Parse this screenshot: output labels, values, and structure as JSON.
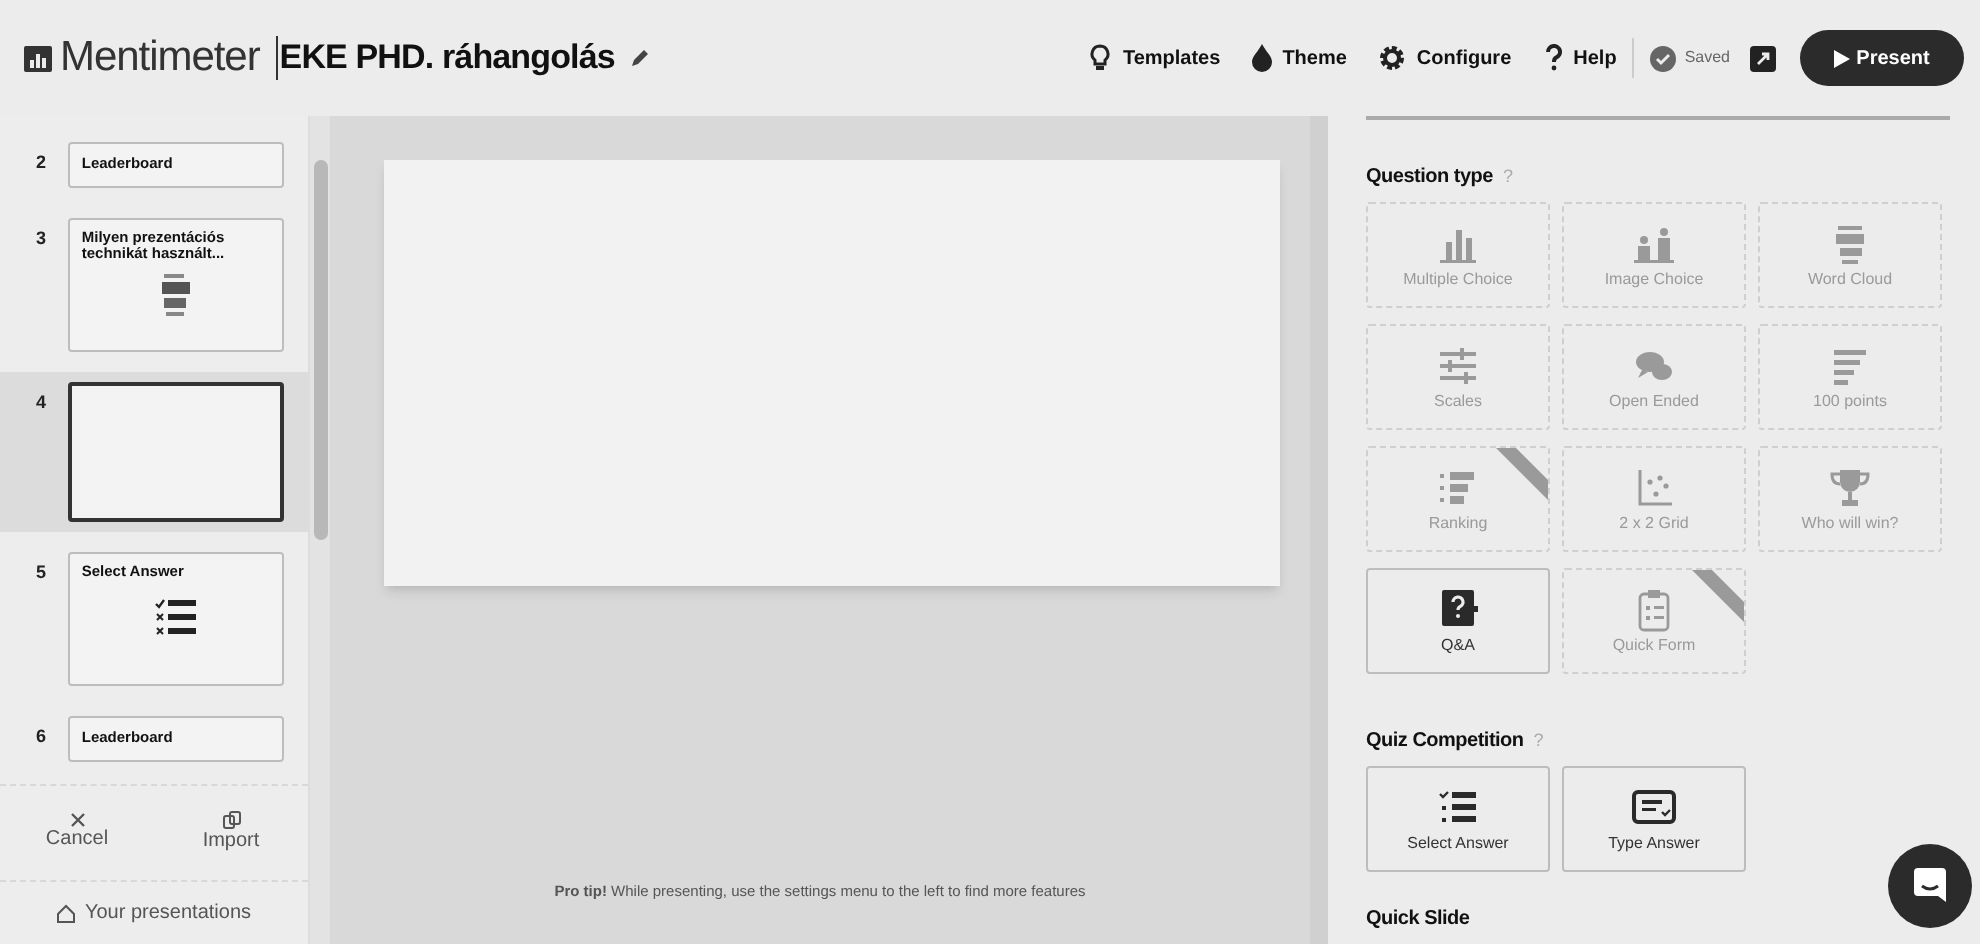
{
  "header": {
    "logo": "Mentimeter",
    "title": "EKE PHD. ráhangolás",
    "nav": [
      {
        "label": "Templates",
        "kind": "bulb"
      },
      {
        "label": "Theme",
        "kind": "drop"
      },
      {
        "label": "Configure",
        "kind": "gear"
      },
      {
        "label": "Help",
        "kind": "help"
      }
    ],
    "status": "Saved",
    "present": "Present"
  },
  "slides": [
    {
      "number": "2",
      "title": "Leaderboard",
      "kind": "leaderboard",
      "selected": false
    },
    {
      "number": "3",
      "title": "Milyen prezentációs technikát használt...",
      "kind": "wordcloud",
      "selected": false
    },
    {
      "number": "4",
      "kind": "blank",
      "selected": true
    },
    {
      "number": "5",
      "title": "Select Answer",
      "kind": "select",
      "selected": false
    },
    {
      "number": "6",
      "title": "Leaderboard",
      "kind": "leaderboard",
      "selected": false
    }
  ],
  "sidebar_actions": [
    {
      "label": "Cancel",
      "kind": "close"
    },
    {
      "label": "Import",
      "kind": "import"
    }
  ],
  "your_presentations": "Your presentations",
  "pro_tip": "**Pro tip!** While presenting, use the settings menu to the left to find more features",
  "question_type": {
    "title": "Question type",
    "help": "?",
    "types": [
      {
        "label": "Multiple Choice",
        "kind": "bars",
        "disabled": true,
        "new": false
      },
      {
        "label": "Image Choice",
        "kind": "images",
        "disabled": true,
        "new": false
      },
      {
        "label": "Word Cloud",
        "kind": "cloud",
        "disabled": true,
        "new": false
      },
      {
        "label": "Scales",
        "kind": "scales",
        "disabled": true,
        "new": false
      },
      {
        "label": "Open Ended",
        "kind": "chat",
        "disabled": true,
        "new": false
      },
      {
        "label": "100 points",
        "kind": "lines",
        "disabled": true,
        "new": false
      },
      {
        "label": "Ranking",
        "kind": "ranking",
        "disabled": true,
        "new": true
      },
      {
        "label": "2 x 2 Grid",
        "kind": "grid",
        "disabled": true,
        "new": false
      },
      {
        "label": "Who will win?",
        "kind": "trophy",
        "disabled": true,
        "new": false
      },
      {
        "label": "Q&A",
        "kind": "qa",
        "disabled": false,
        "new": false
      },
      {
        "label": "Quick Form",
        "kind": "form",
        "disabled": true,
        "new": true
      }
    ]
  },
  "quiz": {
    "title": "Quiz Competition",
    "help": "?",
    "types": [
      {
        "label": "Select Answer",
        "kind": "select",
        "disabled": false,
        "new": false
      },
      {
        "label": "Type Answer",
        "kind": "type",
        "disabled": false,
        "new": false
      }
    ]
  },
  "quick_slide": {
    "title": "Quick Slide"
  }
}
